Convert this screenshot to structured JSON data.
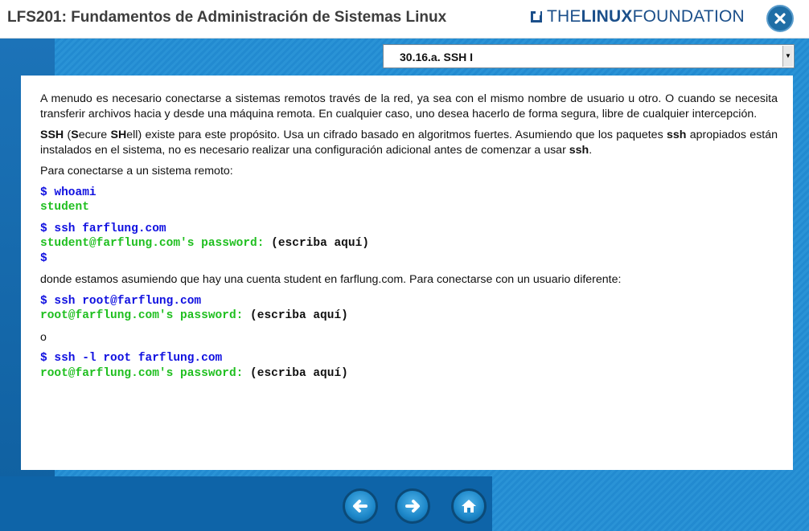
{
  "header": {
    "course_title": "LFS201: Fundamentos de Administración de Sistemas Linux",
    "logo_text_pre": "THE",
    "logo_text_bold": "LINUX",
    "logo_text_post": " FOUNDATION",
    "close_icon": "close-icon"
  },
  "section_selector": {
    "selected": "30.16.a. SSH I"
  },
  "content": {
    "p1": "A menudo es necesario conectarse a sistemas remotos través de la red, ya sea con el mismo nombre de usuario u otro. O cuando se necesita transferir archivos hacia y desde una máquina remota. En cualquier caso, uno desea hacerlo de forma segura, libre de cualquier intercepción.",
    "p2_ssh": "SSH",
    "p2_open": " (",
    "p2_s": "S",
    "p2_ecure": "ecure ",
    "p2_sh": "SH",
    "p2_rest1": "ell) existe para este propósito. Usa un cifrado basado en algoritmos fuertes. Asumiendo que los paquetes ",
    "p2_ssh2": "ssh",
    "p2_rest2": " apropiados están instalados en el sistema, no es necesario realizar una configuración adicional antes de comenzar a usar ",
    "p2_ssh3": "ssh",
    "p2_end": ".",
    "p3": "Para conectarse a un sistema remoto:",
    "code1_cmd": "$ whoami",
    "code1_out": "student",
    "code2_cmd": "$ ssh farflung.com",
    "code2_prompt": "student@farflung.com's password:",
    "code2_note": " (escriba aquí)",
    "code2_dollar": "$",
    "p4": "donde estamos asumiendo que hay una cuenta student en farflung.com. Para conectarse con un usuario diferente:",
    "code3_cmd": "$ ssh root@farflung.com",
    "code3_prompt": "root@farflung.com's password:",
    "code3_note": " (escriba aquí)",
    "p5": "o",
    "code4_cmd": "$ ssh -l root farflung.com",
    "code4_prompt": "root@farflung.com's password:",
    "code4_note": " (escriba aquí)"
  },
  "navigation": {
    "back_icon": "arrow-left-icon",
    "next_icon": "arrow-right-icon",
    "home_icon": "home-icon"
  },
  "colors": {
    "command": "#1010e0",
    "output": "#1fbf1f",
    "brand_blue": "#1b4f8a",
    "background": "#1a7fc4"
  }
}
